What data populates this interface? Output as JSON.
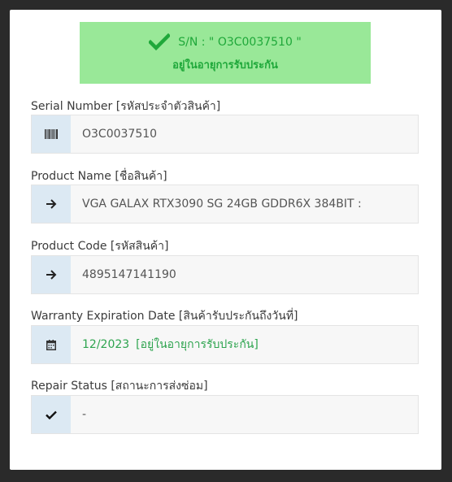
{
  "status": {
    "serial_line": "S/N : \" O3C0037510 \"",
    "message": "อยู่ในอายุการรับประกัน",
    "color": "#1fa83a",
    "background": "#99e898"
  },
  "fields": {
    "serial": {
      "label": "Serial Number [รหัสประจำตัวสินค้า]",
      "value": "O3C0037510",
      "icon": "barcode-icon"
    },
    "product_name": {
      "label": "Product Name [ชื่อสินค้า]",
      "value": "VGA GALAX RTX3090 SG 24GB GDDR6X 384BIT :",
      "icon": "arrow-right-icon"
    },
    "product_code": {
      "label": "Product Code [รหัสสินค้า]",
      "value": "4895147141190",
      "icon": "arrow-right-icon"
    },
    "warranty": {
      "label": "Warranty Expiration Date [สินค้ารับประกันถึงวันที่]",
      "date": "12/2023",
      "note": "[อยู่ในอายุการรับประกัน]",
      "icon": "calendar-icon",
      "color": "#2ea44f"
    },
    "repair": {
      "label": "Repair Status [สถานะการส่งซ่อม]",
      "value": "-",
      "icon": "check-icon"
    }
  }
}
